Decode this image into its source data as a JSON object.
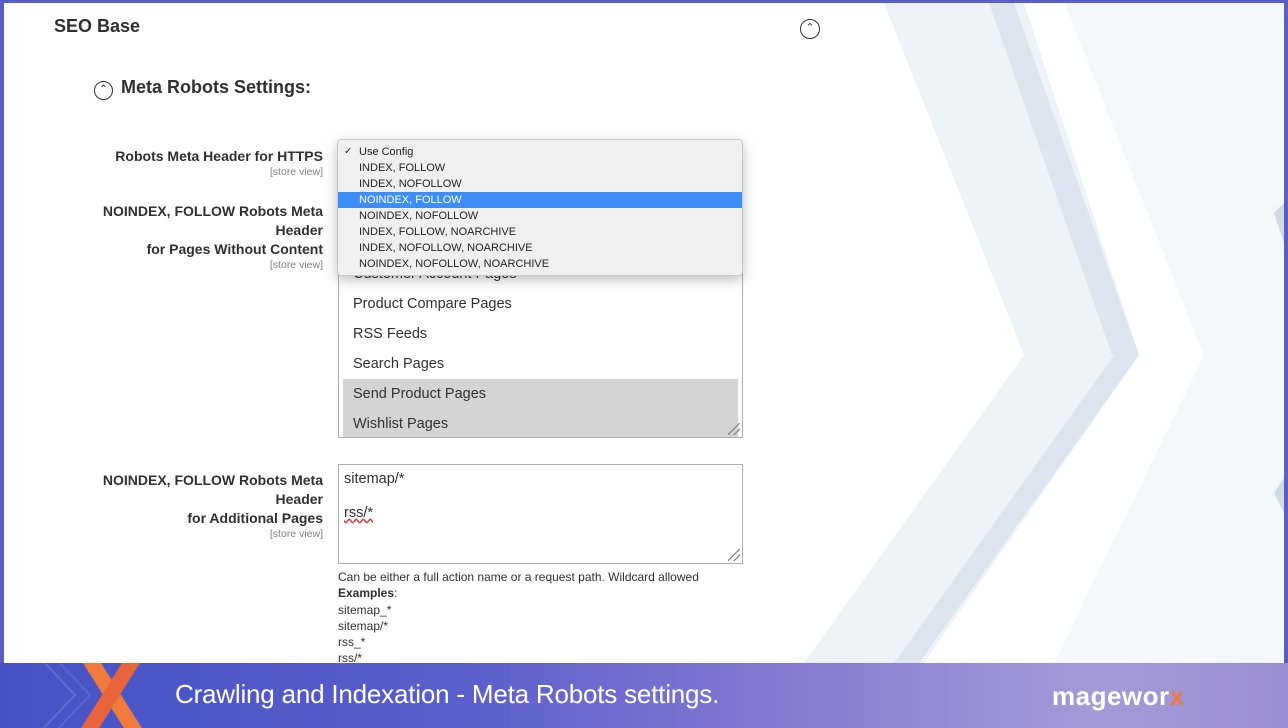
{
  "section": {
    "title": "SEO Base",
    "collapse_glyph": "⌃"
  },
  "subsection": {
    "title": "Meta Robots Settings:",
    "glyph": "⌃"
  },
  "fields": {
    "https_header": {
      "label": "Robots Meta Header for HTTPS",
      "scope": "[store view]",
      "dropdown": {
        "checked_index": 0,
        "highlighted_index": 3,
        "options": [
          "Use Config",
          "INDEX, FOLLOW",
          "INDEX, NOFOLLOW",
          "NOINDEX, FOLLOW",
          "NOINDEX, NOFOLLOW",
          "INDEX, FOLLOW, NOARCHIVE",
          "INDEX, NOFOLLOW, NOARCHIVE",
          "NOINDEX, NOFOLLOW, NOARCHIVE"
        ],
        "check_glyph": "✓"
      }
    },
    "no_content": {
      "label_line1": "NOINDEX, FOLLOW Robots Meta",
      "label_line2": "Header",
      "label_line3": "for Pages Without Content",
      "scope": "[store view]",
      "options": [
        {
          "label": "Customer Account Pages",
          "selected": false
        },
        {
          "label": "Product Compare Pages",
          "selected": false
        },
        {
          "label": "RSS Feeds",
          "selected": false
        },
        {
          "label": "Search Pages",
          "selected": false
        },
        {
          "label": "Send Product Pages",
          "selected": true
        },
        {
          "label": "Wishlist Pages",
          "selected": true
        }
      ]
    },
    "additional": {
      "label_line1": "NOINDEX, FOLLOW Robots Meta",
      "label_line2": "Header",
      "label_line3": "for Additional Pages",
      "scope": "[store view]",
      "value_line1": "sitemap/*",
      "value_line2": "rss/*",
      "note": "Can be either a full action name or a request path. Wildcard allowed",
      "examples_label": "Examples",
      "examples": [
        "sitemap_*",
        "sitemap/*",
        "rss_*",
        "rss/*"
      ]
    }
  },
  "footer": {
    "caption": "Crawling and Indexation - Meta Robots settings.",
    "brand_main": "magewor",
    "brand_x": "x"
  },
  "colors": {
    "highlight": "#3e8ef7",
    "brand_orange": "#f07a3c",
    "selected_option": "#d4d4d4"
  }
}
